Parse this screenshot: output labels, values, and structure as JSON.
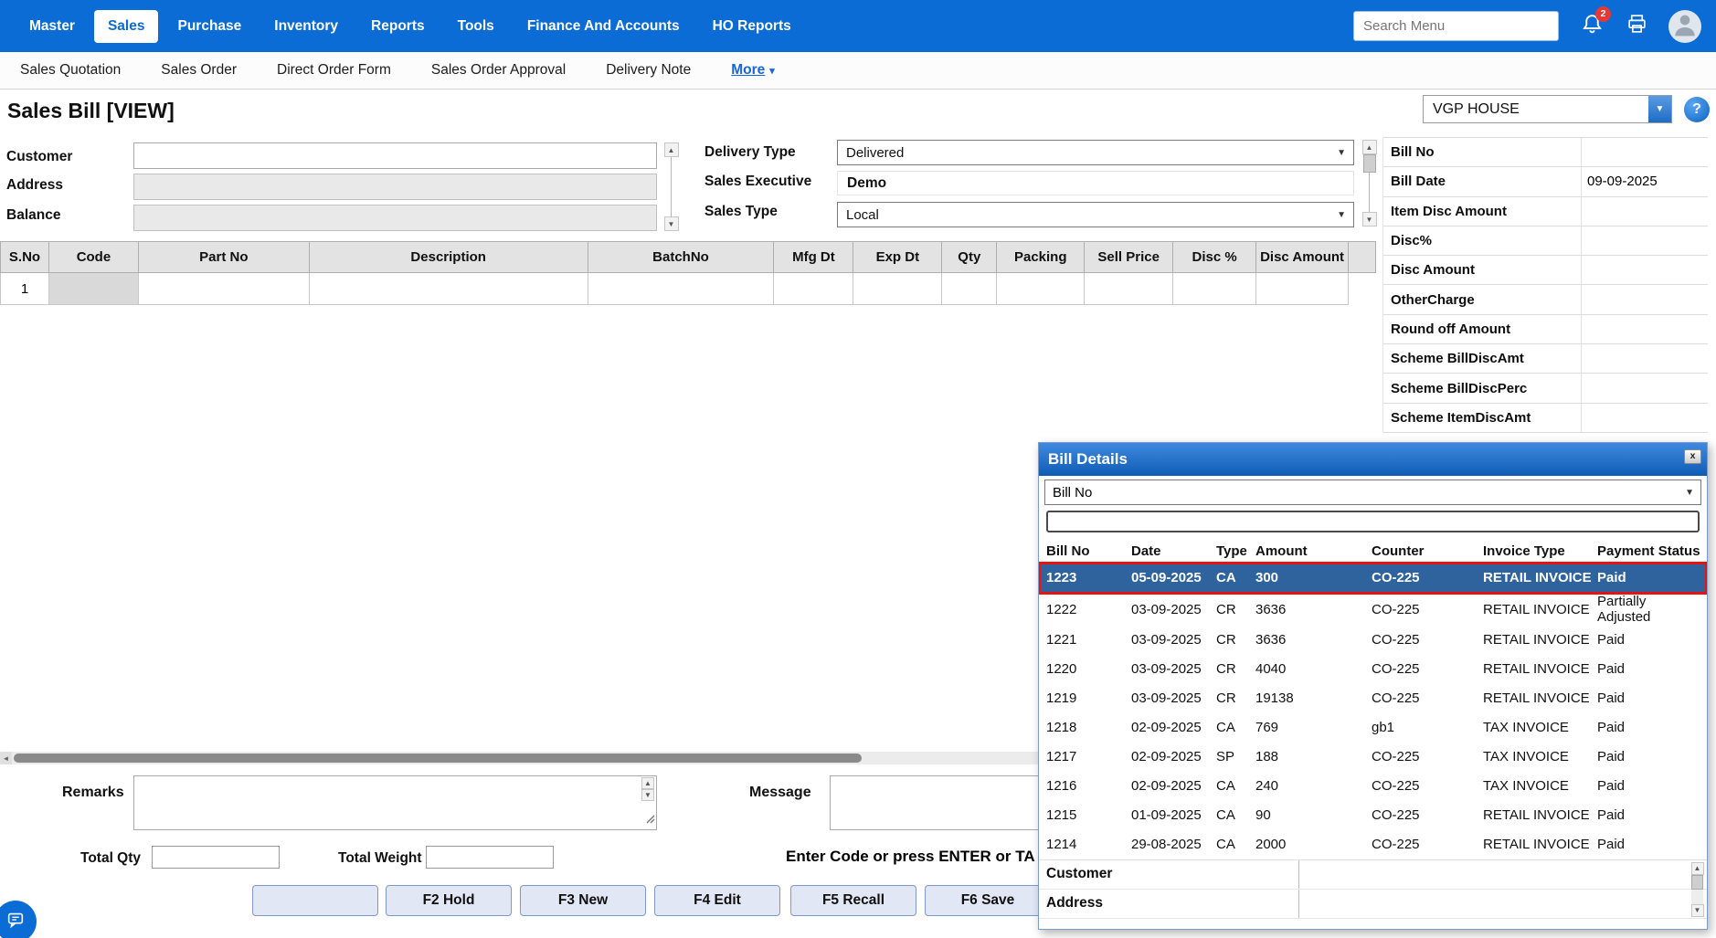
{
  "colors": {
    "accent_blue": "#0c6cd6",
    "popup_header_start": "#3f8ae0",
    "popup_header_end": "#0f5cb5",
    "selected_row_bg": "#2e639e",
    "selected_row_border": "#e81212",
    "notification_badge": "#e53935"
  },
  "top_nav": {
    "items": [
      {
        "label": "Master"
      },
      {
        "label": "Sales"
      },
      {
        "label": "Purchase"
      },
      {
        "label": "Inventory"
      },
      {
        "label": "Reports"
      },
      {
        "label": "Tools"
      },
      {
        "label": "Finance And Accounts"
      },
      {
        "label": "HO Reports"
      }
    ],
    "active": "Sales",
    "search_placeholder": "Search Menu",
    "notification_count": "2"
  },
  "sub_nav": {
    "items": [
      {
        "label": "Sales Quotation"
      },
      {
        "label": "Sales Order"
      },
      {
        "label": "Direct Order Form"
      },
      {
        "label": "Sales Order Approval"
      },
      {
        "label": "Delivery Note"
      },
      {
        "label": "More",
        "emphasized": true,
        "has_caret": true
      }
    ]
  },
  "page": {
    "title": "Sales Bill [VIEW]",
    "branch": "VGP HOUSE",
    "help": "?"
  },
  "form": {
    "customer_label": "Customer",
    "customer_value": "",
    "address_label": "Address",
    "address_value": "",
    "balance_label": "Balance",
    "balance_value": "",
    "delivery_type_label": "Delivery Type",
    "delivery_type_value": "Delivered",
    "sales_executive_label": "Sales Executive",
    "sales_executive_value": "Demo",
    "sales_type_label": "Sales Type",
    "sales_type_value": "Local"
  },
  "side_fields": [
    {
      "label": "Bill No",
      "value": ""
    },
    {
      "label": "Bill Date",
      "value": "09-09-2025"
    },
    {
      "label": "Item Disc Amount",
      "value": ""
    },
    {
      "label": "Disc%",
      "value": ""
    },
    {
      "label": "Disc Amount",
      "value": ""
    },
    {
      "label": "OtherCharge",
      "value": ""
    },
    {
      "label": "Round off Amount",
      "value": ""
    },
    {
      "label": "Scheme BillDiscAmt",
      "value": ""
    },
    {
      "label": "Scheme BillDiscPerc",
      "value": ""
    },
    {
      "label": "Scheme ItemDiscAmt",
      "value": ""
    }
  ],
  "items_table": {
    "headers": [
      "S.No",
      "Code",
      "Part No",
      "Description",
      "BatchNo",
      "Mfg Dt",
      "Exp Dt",
      "Qty",
      "Packing",
      "Sell Price",
      "Disc %",
      "Disc Amount"
    ],
    "first_row_sno": "1"
  },
  "footer": {
    "remarks_label": "Remarks",
    "remarks_value": "",
    "message_label": "Message",
    "message_value": "",
    "total_qty_label": "Total Qty",
    "total_qty_value": "",
    "total_weight_label": "Total Weight",
    "total_weight_value": "",
    "hint": "Enter Code or press ENTER or TA",
    "buttons": [
      "",
      "F2 Hold",
      "F3 New",
      "F4 Edit",
      "F5 Recall",
      "F6 Save"
    ]
  },
  "bill_details": {
    "title": "Bill Details",
    "close": "x",
    "filter_value": "Bill No",
    "search_value": "",
    "headers": [
      "Bill No",
      "Date",
      "Type",
      "Amount",
      "Counter",
      "Invoice Type",
      "Payment Status"
    ],
    "rows": [
      {
        "bill_no": "1223",
        "date": "05-09-2025",
        "type": "CA",
        "amount": "300",
        "counter": "CO-225",
        "invoice_type": "RETAIL INVOICE",
        "payment_status": "Paid",
        "selected": true
      },
      {
        "bill_no": "1222",
        "date": "03-09-2025",
        "type": "CR",
        "amount": "3636",
        "counter": "CO-225",
        "invoice_type": "RETAIL INVOICE",
        "payment_status": "Partially Adjusted"
      },
      {
        "bill_no": "1221",
        "date": "03-09-2025",
        "type": "CR",
        "amount": "3636",
        "counter": "CO-225",
        "invoice_type": "RETAIL INVOICE",
        "payment_status": "Paid"
      },
      {
        "bill_no": "1220",
        "date": "03-09-2025",
        "type": "CR",
        "amount": "4040",
        "counter": "CO-225",
        "invoice_type": "RETAIL INVOICE",
        "payment_status": "Paid"
      },
      {
        "bill_no": "1219",
        "date": "03-09-2025",
        "type": "CR",
        "amount": "19138",
        "counter": "CO-225",
        "invoice_type": "RETAIL INVOICE",
        "payment_status": "Paid"
      },
      {
        "bill_no": "1218",
        "date": "02-09-2025",
        "type": "CA",
        "amount": "769",
        "counter": "gb1",
        "invoice_type": "TAX INVOICE",
        "payment_status": "Paid"
      },
      {
        "bill_no": "1217",
        "date": "02-09-2025",
        "type": "SP",
        "amount": "188",
        "counter": "CO-225",
        "invoice_type": "TAX INVOICE",
        "payment_status": "Paid"
      },
      {
        "bill_no": "1216",
        "date": "02-09-2025",
        "type": "CA",
        "amount": "240",
        "counter": "CO-225",
        "invoice_type": "TAX INVOICE",
        "payment_status": "Paid"
      },
      {
        "bill_no": "1215",
        "date": "01-09-2025",
        "type": "CA",
        "amount": "90",
        "counter": "CO-225",
        "invoice_type": "RETAIL INVOICE",
        "payment_status": "Paid"
      },
      {
        "bill_no": "1214",
        "date": "29-08-2025",
        "type": "CA",
        "amount": "2000",
        "counter": "CO-225",
        "invoice_type": "RETAIL INVOICE",
        "payment_status": "Paid"
      }
    ],
    "customer_label": "Customer",
    "address_label": "Address"
  }
}
